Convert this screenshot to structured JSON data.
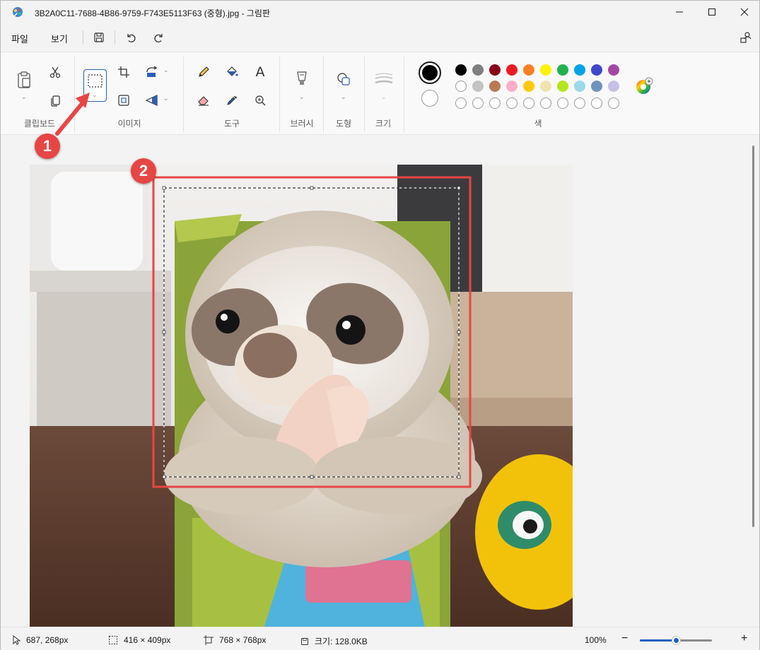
{
  "titlebar": {
    "title": "3B2A0C11-7688-4B86-9759-F743E5113F63 (중형).jpg - 그림판"
  },
  "menubar": {
    "file": "파일",
    "view": "보기"
  },
  "ribbon": {
    "groups": {
      "clipboard": "클립보드",
      "image": "이미지",
      "tools": "도구",
      "brush": "브러시",
      "shapes": "도형",
      "size": "크기",
      "colors": "색"
    },
    "text_tool_glyph": "A",
    "current_color_primary": "#000000",
    "current_color_secondary": "#ffffff",
    "palette_row1": [
      "#000000",
      "#7f7f7f",
      "#880015",
      "#ed1c24",
      "#ff7f27",
      "#fff200",
      "#22b14c",
      "#00a2e8",
      "#3f48cc",
      "#a349a4"
    ],
    "palette_row2": [
      "#ffffff",
      "#c3c3c3",
      "#b97a57",
      "#ffaec9",
      "#ffc90e",
      "#efe4b0",
      "#b5e61d",
      "#99d9ea",
      "#7092be",
      "#c8bfe7"
    ],
    "palette_row3_count": 10
  },
  "annotations": {
    "marker1": "1",
    "marker2": "2",
    "accent": "#e84545"
  },
  "statusbar": {
    "cursor_pos": "687, 268px",
    "selection_size": "416 × 409px",
    "canvas_size": "768 × 768px",
    "file_size": "크기: 128.0KB",
    "zoom": "100%",
    "zoom_minus": "−",
    "zoom_plus": "+"
  }
}
